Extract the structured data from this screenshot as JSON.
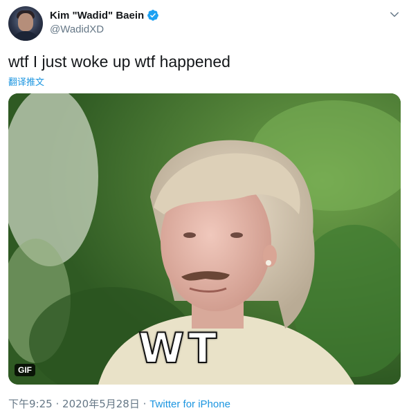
{
  "author": {
    "display_name": "Kim \"Wadid\" Baein",
    "handle": "@WadidXD",
    "verified": true
  },
  "tweet": {
    "text": "wtf I just woke up wtf happened",
    "translate_label": "翻译推文"
  },
  "media": {
    "type_badge": "GIF",
    "caption_overlay": "WT"
  },
  "meta": {
    "time": "下午9:25",
    "separator1": "·",
    "date": "2020年5月28日",
    "separator2": "·",
    "source": "Twitter for iPhone"
  },
  "colors": {
    "accent": "#1b95e0",
    "secondary_text": "#657786",
    "verified": "#1da1f2"
  },
  "icons": {
    "verified": "verified-badge-icon",
    "menu": "chevron-down-icon"
  }
}
